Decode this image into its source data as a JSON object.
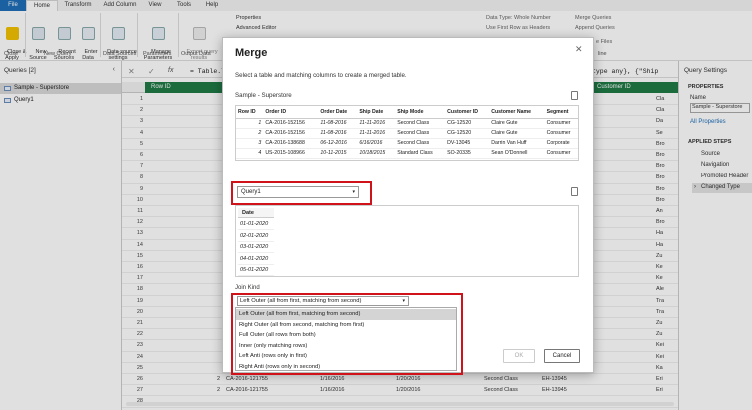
{
  "ribbon": {
    "tabs": [
      "File",
      "Home",
      "Transform",
      "Add Column",
      "View",
      "Tools",
      "Help"
    ],
    "buttons": {
      "close_apply": "Close &\nApply",
      "new_source": "New\nSource",
      "recent_sources": "Recent\nSources",
      "enter_data": "Enter\nData",
      "data_source_settings": "Data source\nsettings",
      "manage_parameters": "Manage\nParameters",
      "export_query": "Export query\nresults",
      "properties": "Properties",
      "advanced_editor": "Advanced Editor",
      "data_type": "Data Type: Whole Number",
      "use_first_row": "Use First Row as Headers",
      "merge_queries": "Merge Queries",
      "append_queries": "Append Queries",
      "files": "e Files",
      "line": "line"
    },
    "groups": {
      "close": "Close",
      "new_query": "New Query",
      "data_sources": "Data Sources",
      "parameters": "Parameters",
      "output_data": "Output Data"
    }
  },
  "formula_bar": {
    "prefix": "= Table.T",
    "suffix": "type any}, {\"Ship"
  },
  "queries_pane": {
    "header": "Queries [2]",
    "items": [
      "Sample - Superstore",
      "Query1"
    ]
  },
  "grid": {
    "row_id_header": "Row ID",
    "right_header": "Customer ID",
    "row_numbers": [
      "1",
      "2",
      "3",
      "4",
      "5",
      "6",
      "7",
      "8",
      "9",
      "10",
      "11",
      "12",
      "13",
      "14",
      "15",
      "16",
      "17",
      "18",
      "19",
      "20",
      "21",
      "22",
      "23",
      "24",
      "25",
      "26",
      "27",
      "28"
    ],
    "left_values": [
      "",
      "",
      "",
      "",
      "",
      "",
      "",
      "",
      "",
      "",
      "",
      "",
      "",
      "",
      "",
      "",
      "",
      "",
      "",
      "",
      "",
      "",
      "",
      "",
      "",
      "2",
      "2",
      ""
    ],
    "right_values": [
      "Cla",
      "Cla",
      "Da",
      "Se",
      "Bro",
      "Bro",
      "Bro",
      "Bro",
      "Bro",
      "Bro",
      "An",
      "Bro",
      "Ha",
      "Ha",
      "Zu",
      "Ke",
      "Ke",
      "Ale",
      "Tra",
      "Tra",
      "Zu",
      "Zu",
      "Kei",
      "Kei",
      "Ka",
      "Eri",
      "Eri",
      ""
    ],
    "rows_26_27": [
      {
        "num": "26",
        "id": "CA-2016-121755",
        "order_date": "1/16/2016",
        "ship_date": "1/20/2016",
        "mode": "Second Class",
        "cust": "EH-13945",
        "name": "Eri"
      },
      {
        "num": "27",
        "id": "CA-2016-121755",
        "order_date": "1/16/2016",
        "ship_date": "1/20/2016",
        "mode": "Second Class",
        "cust": "EH-13945",
        "name": "Eri"
      }
    ]
  },
  "settings_pane": {
    "title": "Query Settings",
    "properties_head": "PROPERTIES",
    "name_label": "Name",
    "name_value": "Sample - Superstore",
    "all_properties": "All Properties",
    "steps_head": "APPLIED STEPS",
    "steps": [
      "Source",
      "Navigation",
      "Promoted Header",
      "Changed Type"
    ]
  },
  "dialog": {
    "title": "Merge",
    "subtitle": "Select a table and matching columns to create a merged table.",
    "table1_label": "Sample - Superstore",
    "preview_headers": [
      "Row ID",
      "Order ID",
      "Order Date",
      "Ship Date",
      "Ship Mode",
      "Customer ID",
      "Customer Name",
      "Segment"
    ],
    "preview_rows": [
      [
        "1",
        "CA-2016-152156",
        "11-08-2016",
        "11-11-2016",
        "Second Class",
        "CG-12520",
        "Claire Gute",
        "Consumer"
      ],
      [
        "2",
        "CA-2016-152156",
        "11-08-2016",
        "11-11-2016",
        "Second Class",
        "CG-12520",
        "Claire Gute",
        "Consumer"
      ],
      [
        "3",
        "CA-2016-138688",
        "06-12-2016",
        "6/16/2016",
        "Second Class",
        "DV-13045",
        "Darrin Van Huff",
        "Corporate"
      ],
      [
        "4",
        "US-2015-108966",
        "10-11-2015",
        "10/18/2015",
        "Standard Class",
        "SO-20335",
        "Sean O'Donnell",
        "Consumer"
      ],
      [
        "5",
        "US-2015-108966",
        "10-11-2015",
        "10/18/2015",
        "Standard Class",
        "SO-20335",
        "Sean O'Donnell",
        "Consumer"
      ]
    ],
    "second_table": "Query1",
    "date_header": "Date",
    "dates": [
      "01-01-2020",
      "02-01-2020",
      "03-01-2020",
      "04-01-2020",
      "05-01-2020"
    ],
    "join_kind_label": "Join Kind",
    "join_kind_selected": "Left Outer (all from first, matching from second)",
    "join_options": [
      "Left Outer (all from first, matching from second)",
      "Right Outer (all from second, matching from first)",
      "Full Outer (all rows from both)",
      "Inner (only matching rows)",
      "Left Anti (rows only in first)",
      "Right Anti (rows only in second)"
    ],
    "ok_label": "OK",
    "cancel_label": "Cancel"
  },
  "colors": {
    "accent": "#1f6fb8",
    "column_header": "#1f7a46",
    "highlight_box": "#d0121b"
  }
}
